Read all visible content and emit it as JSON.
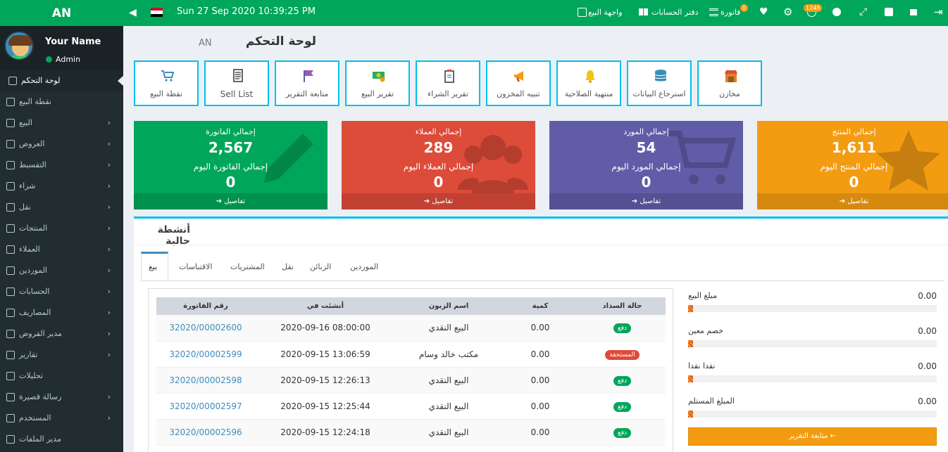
{
  "brand": "AN",
  "user": {
    "name": "Your Name",
    "role": "Admin"
  },
  "sidebar": {
    "items": [
      {
        "label": "لوحة التحكم"
      },
      {
        "label": "نقطة البيع"
      },
      {
        "label": "البيع"
      },
      {
        "label": "العروض"
      },
      {
        "label": "التقسيط"
      },
      {
        "label": "شراء"
      },
      {
        "label": "نقل"
      },
      {
        "label": "المنتجات"
      },
      {
        "label": "العملاء"
      },
      {
        "label": "الموردين"
      },
      {
        "label": "الحسابات"
      },
      {
        "label": "المصاريف"
      },
      {
        "label": "مدير القروض"
      },
      {
        "label": "تقارير"
      },
      {
        "label": "تحليلات"
      },
      {
        "label": "رسالة قصيرة"
      },
      {
        "label": "المستخدم"
      },
      {
        "label": "مدير الملفات"
      }
    ]
  },
  "topbar": {
    "datetime": "Sun 27 Sep 2020 10:39:25 PM",
    "sell_interface": "واجهة البيع",
    "account_book": "دفتر الحسابات",
    "invoice": "فاتورة",
    "invoice_badge": "0",
    "notif_badge": "1248"
  },
  "page": {
    "title": "لوحة التحكم",
    "subtitle": "AN"
  },
  "shortcuts": [
    {
      "label": "نقطة البيع"
    },
    {
      "label": "Sell List"
    },
    {
      "label": "متابعة التقرير"
    },
    {
      "label": "تقرير البيع"
    },
    {
      "label": "تقرير الشراء"
    },
    {
      "label": "تنبيه المخزون"
    },
    {
      "label": "منتهية الصلاحية"
    },
    {
      "label": "استرجاع البيانات"
    },
    {
      "label": "مخازن"
    }
  ],
  "stats": [
    {
      "label": "إجمالي الفاتورة",
      "value": "2,567",
      "today_label": "إجمالي الفاتورة اليوم",
      "today_value": "0",
      "details": "تفاصيل",
      "color": "#00a65a"
    },
    {
      "label": "إجمالي العملاء",
      "value": "289",
      "today_label": "إجمالي العملاء اليوم",
      "today_value": "0",
      "details": "تفاصيل",
      "color": "#dd4b39"
    },
    {
      "label": "إجمالي المورد",
      "value": "54",
      "today_label": "إجمالي المورد اليوم",
      "today_value": "0",
      "details": "تفاصيل",
      "color": "#605ca8"
    },
    {
      "label": "إجمالي المنتج",
      "value": "1,611",
      "today_label": "إجمالي المنتج اليوم",
      "today_value": "0",
      "details": "تفاصيل",
      "color": "#f39c12"
    }
  ],
  "activities": {
    "title": "أنشطة حالية",
    "tabs": [
      "بيع",
      "الاقتباسات",
      "المشتريات",
      "نقل",
      "الزبائن",
      "الموردين"
    ],
    "columns": [
      "حالة السداد",
      "كمية",
      "اسم الزبون",
      "أنشئت في",
      "رقم الفاتورة"
    ],
    "rows": [
      {
        "status": "دفع",
        "status_color": "#00a65a",
        "qty": "0.00",
        "customer": "البيع النقدي",
        "created": "2020-09-16 08:00:00",
        "invoice": "32020/00002600"
      },
      {
        "status": "المستحقة",
        "status_color": "#dd4b39",
        "qty": "0.00",
        "customer": "مكتب خالد وسام",
        "created": "2020-09-15 13:06:59",
        "invoice": "32020/00002599"
      },
      {
        "status": "دفع",
        "status_color": "#00a65a",
        "qty": "0.00",
        "customer": "البيع النقدي",
        "created": "2020-09-15 12:26:13",
        "invoice": "32020/00002598"
      },
      {
        "status": "دفع",
        "status_color": "#00a65a",
        "qty": "0.00",
        "customer": "البيع النقدي",
        "created": "2020-09-15 12:25:44",
        "invoice": "32020/00002597"
      },
      {
        "status": "دفع",
        "status_color": "#00a65a",
        "qty": "0.00",
        "customer": "البيع النقدي",
        "created": "2020-09-15 12:24:18",
        "invoice": "32020/00002596"
      }
    ],
    "summary": [
      {
        "label": "مبلغ البيع",
        "value": "0.00"
      },
      {
        "label": "خصم معين",
        "value": "0.00"
      },
      {
        "label": "نقدا نقدا",
        "value": "0.00"
      },
      {
        "label": "المبلغ المستلم",
        "value": "0.00"
      }
    ],
    "report_button": "← متابعة التقرير"
  }
}
